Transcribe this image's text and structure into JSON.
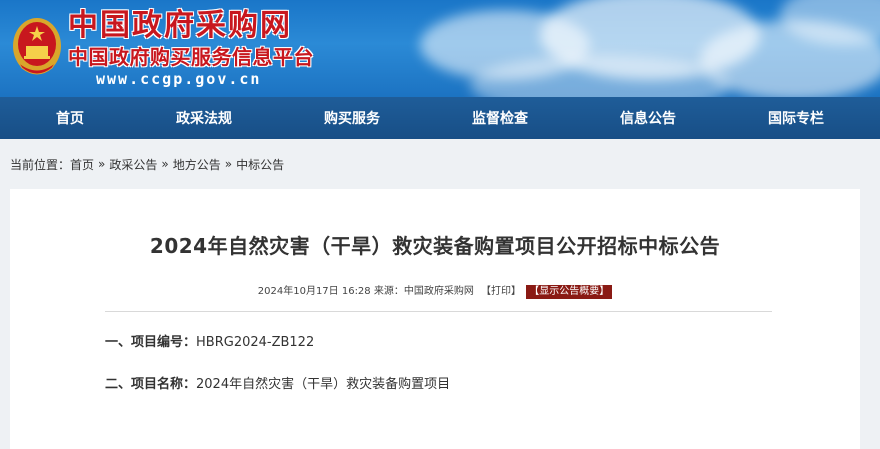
{
  "header": {
    "site_title": "中国政府采购网",
    "site_subtitle": "中国政府购买服务信息平台",
    "site_url": "www.ccgp.gov.cn"
  },
  "nav": {
    "items": [
      "首页",
      "政采法规",
      "购买服务",
      "监督检查",
      "信息公告",
      "国际专栏"
    ]
  },
  "breadcrumb": {
    "prefix": "当前位置：",
    "items": [
      "首页",
      "政采公告",
      "地方公告",
      "中标公告"
    ],
    "separator": "»"
  },
  "article": {
    "title": "2024年自然灾害（干旱）救灾装备购置项目公开招标中标公告",
    "meta": "2024年10月17日 16:28 来源：中国政府采购网",
    "print_label": "【打印】",
    "summary_label": "【显示公告概要】",
    "fields": [
      {
        "label": "一、项目编号：",
        "value": "HBRG2024-ZB122"
      },
      {
        "label": "二、项目名称：",
        "value": "2024年自然灾害（干旱）救灾装备购置项目"
      }
    ]
  },
  "colors": {
    "banner_blue": "#1a76c8",
    "nav_blue": "#1f5d99",
    "title_red": "#c8171e",
    "summary_bg": "#8a1a14"
  }
}
